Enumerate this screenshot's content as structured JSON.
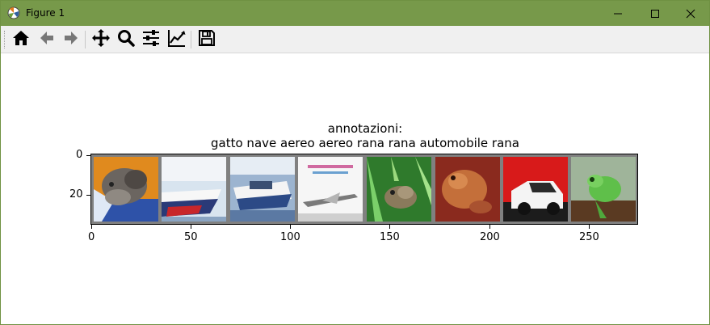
{
  "window": {
    "title": "Figure 1",
    "titlebar_color": "#77994a",
    "icons": [
      "matplotlib-app-icon",
      "minimize-icon",
      "maximize-icon",
      "close-icon"
    ]
  },
  "toolbar": {
    "buttons": [
      {
        "name": "home",
        "icon": "home-icon"
      },
      {
        "name": "back",
        "icon": "arrow-left-icon"
      },
      {
        "name": "forward",
        "icon": "arrow-right-icon"
      },
      {
        "name": "pan",
        "icon": "move-icon"
      },
      {
        "name": "zoom",
        "icon": "magnifier-icon"
      },
      {
        "name": "subplots",
        "icon": "sliders-icon"
      },
      {
        "name": "customize",
        "icon": "line-chart-icon"
      },
      {
        "name": "save",
        "icon": "floppy-disk-icon"
      }
    ]
  },
  "figure": {
    "title_line1": "annotazioni:",
    "title_line2": "gatto  nave aereo aereo  rana  rana automobile  rana",
    "x_ticks": [
      "0",
      "50",
      "100",
      "150",
      "200",
      "250"
    ],
    "y_ticks": [
      "0",
      "20"
    ],
    "images": [
      {
        "label": "gatto",
        "icon": "cat-image"
      },
      {
        "label": "nave",
        "icon": "ship-image"
      },
      {
        "label": "nave",
        "icon": "ship-image"
      },
      {
        "label": "aereo",
        "icon": "airplane-image"
      },
      {
        "label": "rana",
        "icon": "frog-image"
      },
      {
        "label": "rana",
        "icon": "frog-image"
      },
      {
        "label": "automobile",
        "icon": "car-image"
      },
      {
        "label": "rana",
        "icon": "frog-image"
      }
    ]
  }
}
